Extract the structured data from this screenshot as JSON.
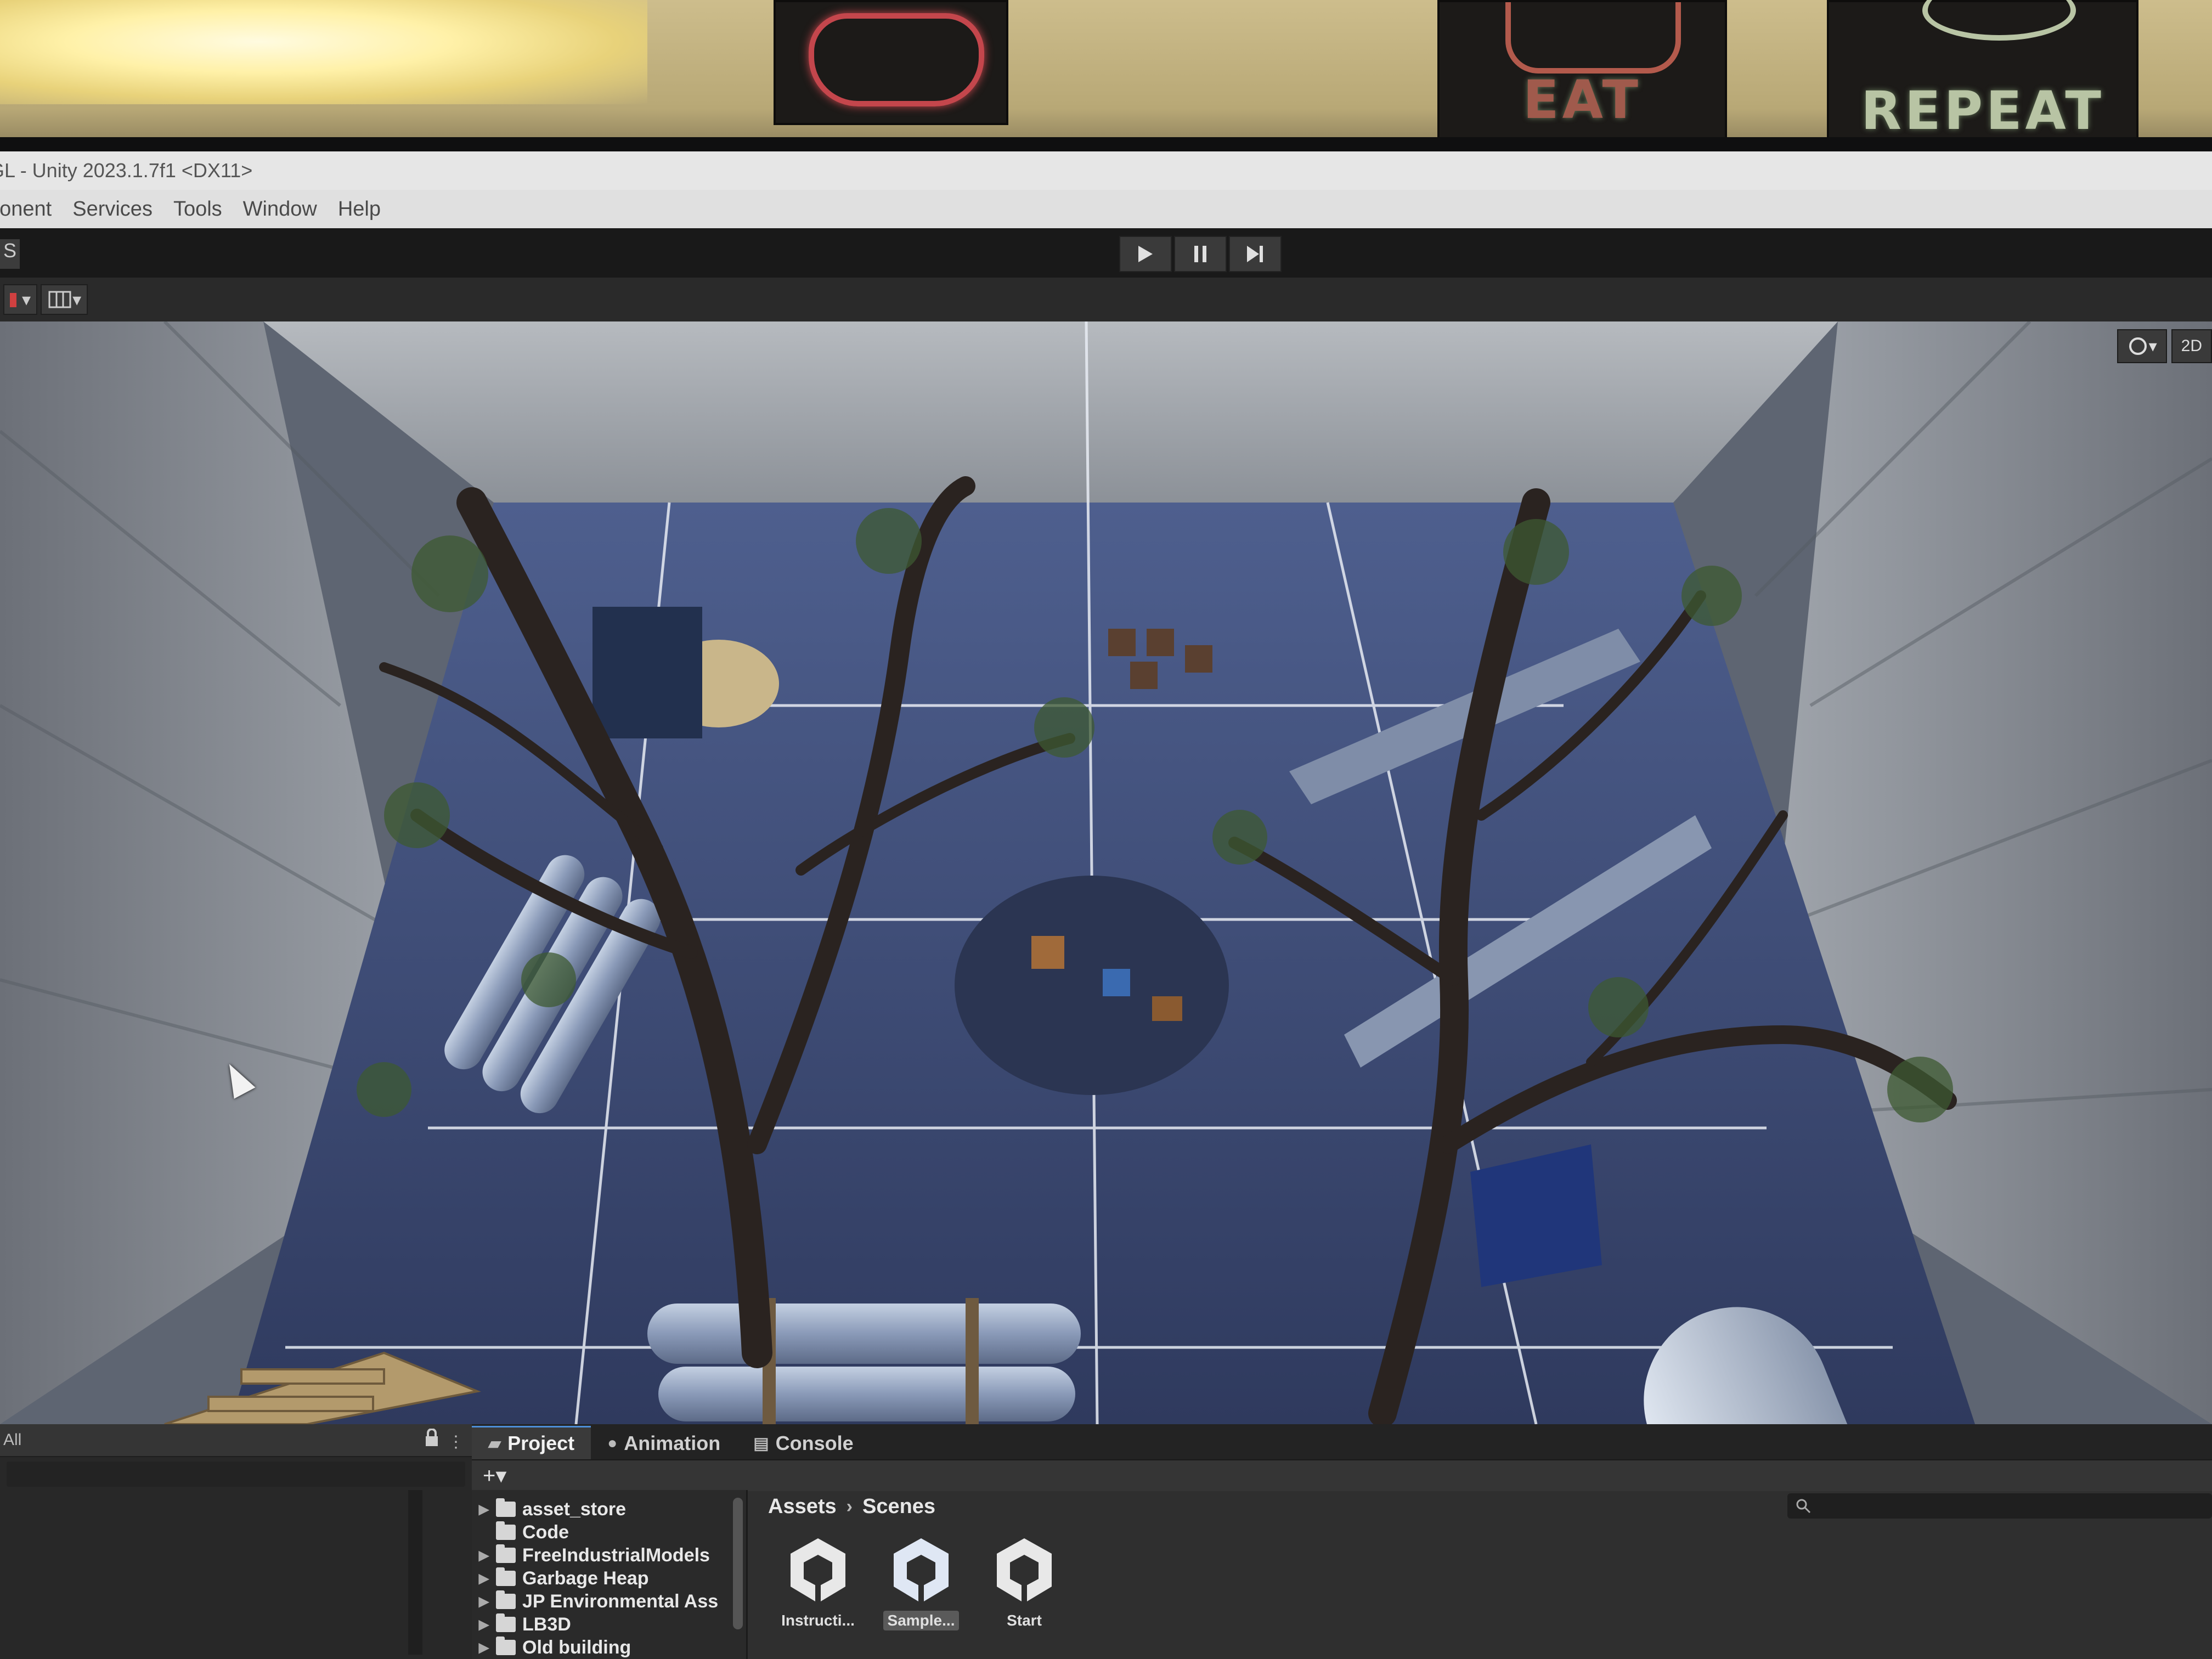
{
  "room": {
    "posters": [
      {
        "text": ""
      },
      {
        "text": "EAT"
      },
      {
        "text": "REPEAT"
      }
    ]
  },
  "window": {
    "title": "GL - Unity 2023.1.7f1 <DX11>"
  },
  "menu": {
    "items": [
      "ponent",
      "Services",
      "Tools",
      "Window",
      "Help"
    ]
  },
  "toolbar": {
    "left_label": "S",
    "play_icon": "play-icon",
    "pause_icon": "pause-icon",
    "step_icon": "step-icon"
  },
  "scene_toolbar": {
    "overlay_2d_label": "2D",
    "gizmo_icon": "gizmo-icon"
  },
  "hierarchy": {
    "search_label": "All"
  },
  "project": {
    "tabs": [
      {
        "label": "Project",
        "icon": "folder-icon"
      },
      {
        "label": "Animation",
        "icon": "animation-icon"
      },
      {
        "label": "Console",
        "icon": "console-icon"
      }
    ],
    "add_label": "+▾",
    "folders": [
      "asset_store",
      "Code",
      "FreeIndustrialModels",
      "Garbage Heap",
      "JP Environmental Ass",
      "LB3D",
      "Old building"
    ],
    "breadcrumb": {
      "root": "Assets",
      "current": "Scenes"
    },
    "assets": [
      {
        "label": "Instructi...",
        "selected": false
      },
      {
        "label": "Sample...",
        "selected": true
      },
      {
        "label": "Start",
        "selected": false
      }
    ]
  },
  "colors": {
    "unity_dark": "#383838",
    "accent_tab": "#4d8ed8",
    "floor_blue": "#3a4a78",
    "wall_gray": "#8a8e94"
  }
}
